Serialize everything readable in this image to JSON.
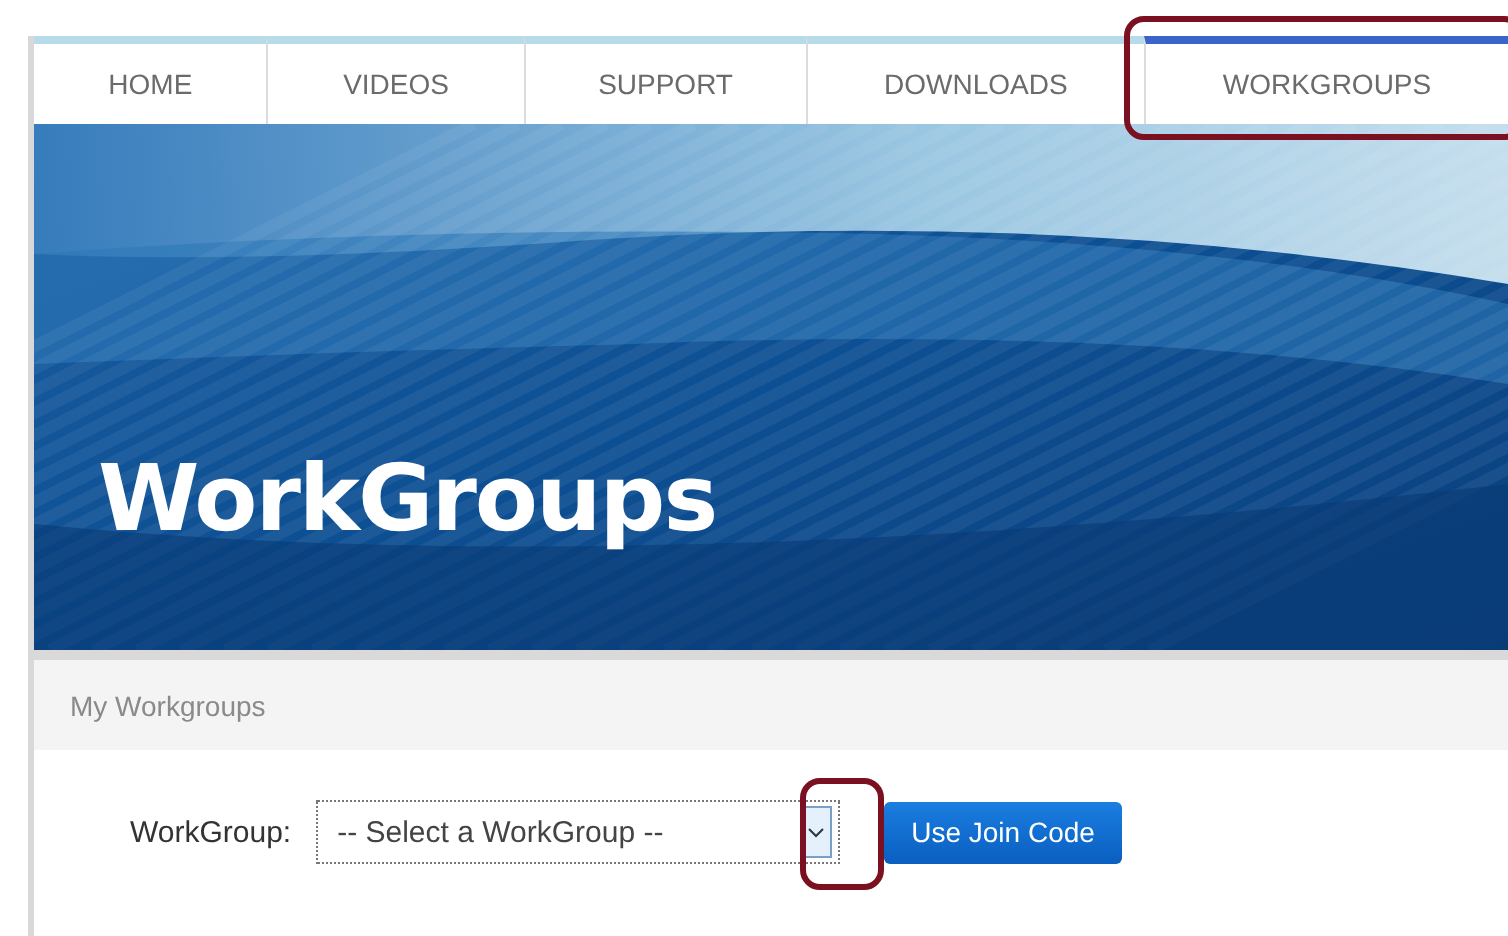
{
  "nav": {
    "tabs": [
      {
        "label": "HOME",
        "selected": false
      },
      {
        "label": "VIDEOS",
        "selected": false
      },
      {
        "label": "SUPPORT",
        "selected": false
      },
      {
        "label": "DOWNLOADS",
        "selected": false
      },
      {
        "label": "WORKGROUPS",
        "selected": true
      }
    ]
  },
  "banner": {
    "title": "WorkGroups"
  },
  "section": {
    "title": "My Workgroups"
  },
  "form": {
    "label": "WorkGroup:",
    "select": {
      "value": "-- Select a WorkGroup --"
    },
    "button": "Use Join Code"
  }
}
